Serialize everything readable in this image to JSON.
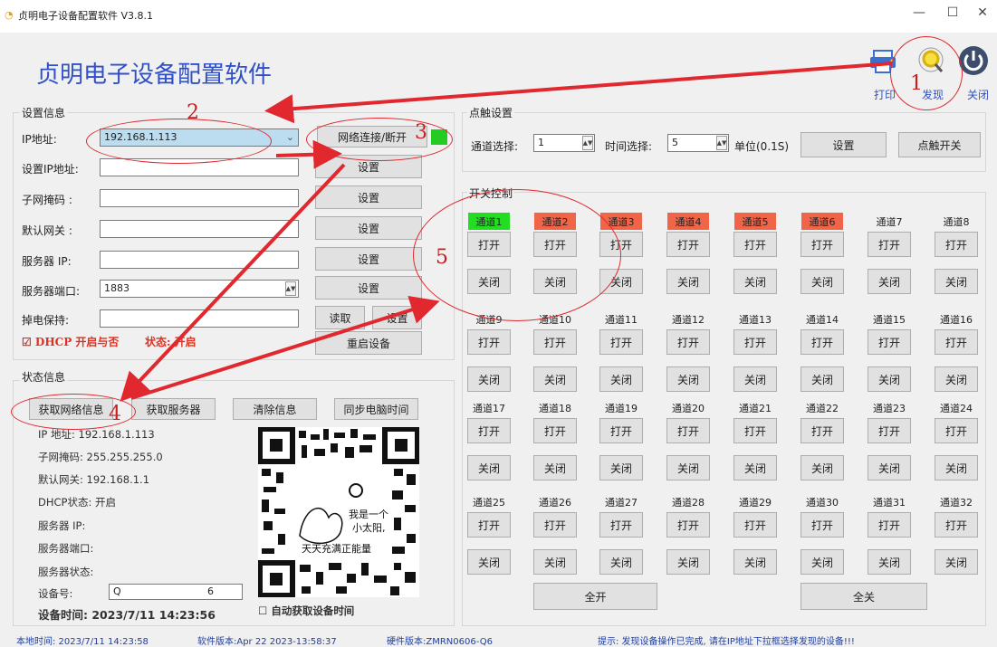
{
  "window": {
    "title": "贞明电子设备配置软件 V3.8.1",
    "min": "—",
    "max": "☐",
    "close": "✕"
  },
  "app_title": "贞明电子设备配置软件",
  "toolbar": {
    "print": "打印",
    "discover": "发现",
    "shutdown": "关闭"
  },
  "settings": {
    "group": "设置信息",
    "ip_label": "IP地址:",
    "ip_value": "192.168.1.113",
    "connect_btn": "网络连接/断开",
    "set_ip_label": "设置IP地址:",
    "mask_label": "子网掩码 :",
    "gateway_label": "默认网关 :",
    "server_ip_label": "服务器 IP:",
    "server_port_label": "服务器端口:",
    "server_port_value": "1883",
    "power_hold_label": "掉电保持:",
    "set_btn": "设置",
    "read_btn": "读取",
    "restart_btn": "重启设备",
    "dhcp_text": "☑ DHCP 开启与否",
    "dhcp_state": "状态: 开启"
  },
  "status": {
    "group": "状态信息",
    "get_net_btn": "获取网络信息",
    "get_server_btn": "获取服务器",
    "clear_btn": "清除信息",
    "sync_btn": "同步电脑时间",
    "ip": "IP 地址: 192.168.1.113",
    "mask": "子网掩码: 255.255.255.0",
    "gateway": "默认网关: 192.168.1.1",
    "dhcp": "DHCP状态:  开启",
    "server_ip": "服务器 IP:",
    "server_port": "服务器端口:",
    "server_state": "服务器状态:",
    "device_no_label": "设备号:",
    "device_no_value": "Q",
    "device_no_extra": "6",
    "device_time": "设备时间: 2023/7/11 14:23:56",
    "auto_time": "☐ 自动获取设备时间",
    "qr_text1": "我是一个",
    "qr_text2": "小太阳,",
    "qr_text3": "天天充满正能量"
  },
  "pulse": {
    "group": "点触设置",
    "channel_label": "通道选择:",
    "channel_value": "1",
    "time_label": "时间选择:",
    "time_value": "5",
    "unit": "单位(0.1S)",
    "set_btn": "设置",
    "switch_btn": "点触开关"
  },
  "switch": {
    "group": "开关控制",
    "open": "打开",
    "close": "关闭",
    "all_on": "全开",
    "all_off": "全关",
    "channels": [
      "通道1",
      "通道2",
      "通道3",
      "通道4",
      "通道5",
      "通道6",
      "通道7",
      "通道8",
      "通道9",
      "通道10",
      "通道11",
      "通道12",
      "通道13",
      "通道14",
      "通道15",
      "通道16",
      "通道17",
      "通道18",
      "通道19",
      "通道20",
      "通道21",
      "通道22",
      "通道23",
      "通道24",
      "通道25",
      "通道26",
      "通道27",
      "通道28",
      "通道29",
      "通道30",
      "通道31",
      "通道32"
    ],
    "channel_states": [
      "on",
      "off",
      "off",
      "off",
      "off",
      "off",
      "none",
      "none",
      "none",
      "none",
      "none",
      "none",
      "none",
      "none",
      "none",
      "none",
      "none",
      "none",
      "none",
      "none",
      "none",
      "none",
      "none",
      "none",
      "none",
      "none",
      "none",
      "none",
      "none",
      "none",
      "none",
      "none"
    ]
  },
  "statusbar": {
    "local_time": "本地时间: 2023/7/11 14:23:58",
    "sw_version": "软件版本:Apr 22 2023-13:58:37",
    "hw_version": "硬件版本:ZMRN0606-Q6",
    "hint": "提示: 发现设备操作已完成, 请在IP地址下拉框选择发现的设备!!!"
  },
  "annotations": [
    "1",
    "2",
    "3",
    "4",
    "5"
  ],
  "colors": {
    "accent": "#3050c8",
    "on": "#22dd22",
    "off": "#f06448",
    "annotation": "#e0282e"
  }
}
